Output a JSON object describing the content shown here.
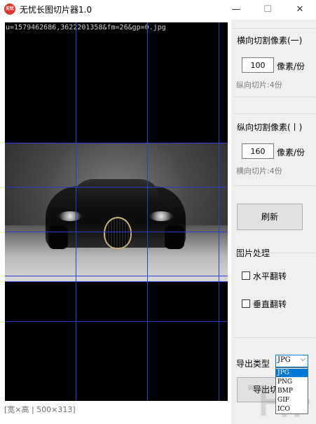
{
  "window": {
    "icon_text": "无忧",
    "title": "无忧长图切片器1.0",
    "minimize": "—",
    "maximize": "☐",
    "close": "✕"
  },
  "canvas": {
    "filename": "u=1579462686,3622201358&fm=26&gp=0.jpg",
    "grid_color": "#2d3bd6"
  },
  "status": {
    "text": "[宽×高 | 500×313]"
  },
  "horizontal": {
    "title": "横向切割像素(一)",
    "value": "100",
    "unit": "像素/份",
    "slices": "纵向切片:4份"
  },
  "vertical": {
    "title": "纵向切割像素(丨)",
    "value": "160",
    "unit": "像素/份",
    "slices": "横向切片:4份"
  },
  "refresh_label": "刷新",
  "image_processing": {
    "title": "图片处理",
    "flip_horizontal": "水平翻转",
    "flip_vertical": "垂直翻转"
  },
  "export": {
    "label": "导出类型",
    "selected": "JPG",
    "options": [
      "JPG",
      "PNG",
      "BMP",
      "GIF",
      "ICO"
    ],
    "button_label": "导出切片"
  },
  "colors": {
    "accent": "#0078d7",
    "canvas_bg": "#000000",
    "panel_bg": "#f0f0f0"
  }
}
